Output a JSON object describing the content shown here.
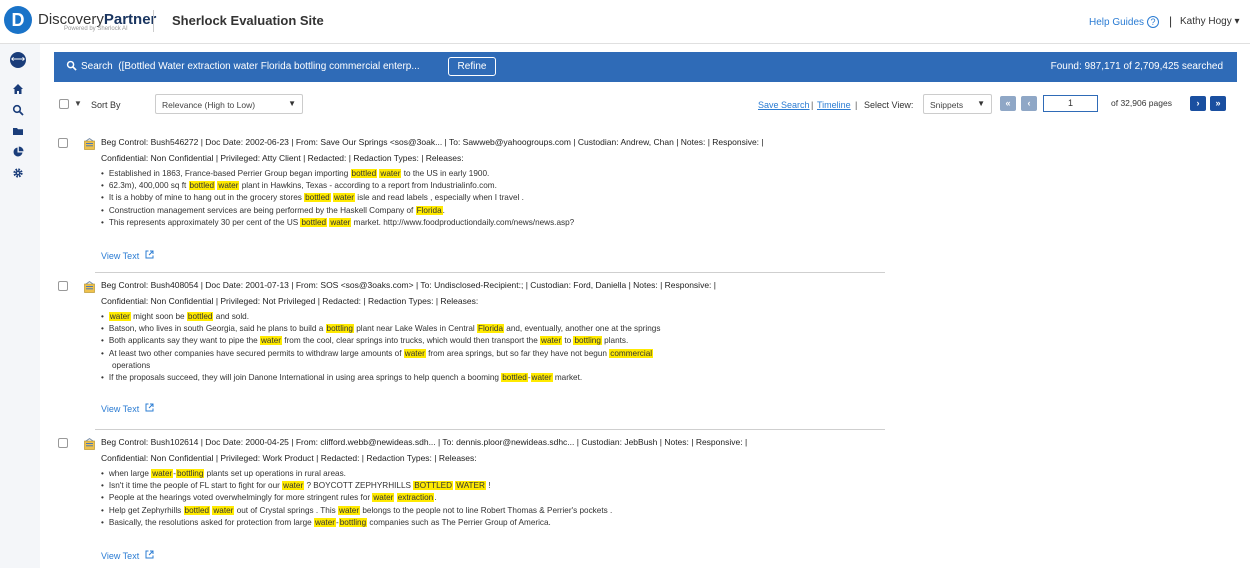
{
  "header": {
    "logo_letter": "D",
    "logo_part1": "Discovery",
    "logo_part2": "Partner",
    "logo_sub": "Powered by Sherlock AI",
    "site_title": "Sherlock Evaluation Site",
    "help_label": "Help Guides",
    "help_icon": "?",
    "user_sep": "|",
    "user_name": "Kathy Hogy ▾"
  },
  "rail": {
    "toggle_icon": "⟷",
    "items": [
      "home-icon",
      "search-icon",
      "folder-icon",
      "pie-chart-icon",
      "gear-icon"
    ]
  },
  "banner": {
    "search_label": "Search",
    "query": "([Bottled Water extraction water Florida bottling commercial enterp...",
    "refine_label": "Refine",
    "found_text": "Found: 987,171 of 2,709,425 searched",
    "color": "#2f6bb7"
  },
  "toolbar": {
    "sort_label": "Sort By",
    "sort_value": "Relevance (High to Low)",
    "save_search": "Save Search",
    "timeline": "Timeline",
    "select_view_label": "Select View:",
    "view_value": "Snippets",
    "first_label": "«",
    "prev_label": "‹",
    "page_value": "1",
    "page_total": "of 32,906 pages",
    "next_label": "›",
    "last_label": "»"
  },
  "documents": [
    {
      "meta1": "Beg Control: Bush546272  |  Doc Date: 2002-06-23  |  From: Save Our Springs <sos@3oak...  |  To: Sawweb@yahoogroups.com  |  Custodian: Andrew, Chan  |  Notes:   |  Responsive:   |",
      "meta2": "Confidential: Non Confidential  |  Privileged: Atty Client  |  Redacted:   |  Redaction Types:   |  Releases:",
      "view_text": "View Text"
    },
    {
      "meta1": "Beg Control: Bush408054  |  Doc Date: 2001-07-13  |  From: SOS <sos@3oaks.com>  |  To: Undisclosed-Recipient:;  |  Custodian: Ford, Daniella  |  Notes:   |  Responsive:   |",
      "meta2": "Confidential: Non Confidential  |  Privileged: Not Privileged  |  Redacted:   |  Redaction Types:   |  Releases:",
      "view_text": "View Text"
    },
    {
      "meta1": "Beg Control: Bush102614  |  Doc Date: 2000-04-25  |  From: clifford.webb@newideas.sdh...  |  To: dennis.ploor@newideas.sdhc...  |  Custodian: JebBush  |  Notes:   |  Responsive:   |",
      "meta2": "Confidential: Non Confidential  |  Privileged: Work Product  |  Redacted:   |  Redaction Types:   |  Releases:",
      "view_text": "View Text"
    }
  ],
  "snippets": {
    "d0": [
      [
        "Established in 1863, France-based Perrier Group began importing ",
        "bottled",
        " ",
        "water",
        " to the US in early 1900."
      ],
      [
        "62.3m), 400,000 sq ft ",
        "bottled",
        " ",
        "water",
        " plant in Hawkins, Texas - according to a report from Industrialinfo.com."
      ],
      [
        "It is a hobby of mine to hang out in the grocery stores ",
        "bottled",
        " ",
        "water",
        " isle and read labels , especially when I travel ."
      ],
      [
        "Construction management services are being performed by the Haskell Company of ",
        "Florida",
        "."
      ],
      [
        "This represents approximately 30 per cent of the US ",
        "bottled",
        " ",
        "water",
        " market. http://www.foodproductiondaily.com/news/news.asp?"
      ]
    ],
    "d1": [
      [
        "",
        "water",
        " might soon be ",
        "bottled",
        " and sold."
      ],
      [
        "Batson, who lives in south Georgia, said he plans to build a ",
        "bottling",
        " plant near Lake Wales in Central ",
        "Florida",
        " and, eventually, another one at the springs"
      ],
      [
        "Both applicants say they want to pipe the ",
        "water",
        " from the cool, clear springs into trucks, which would then transport the ",
        "water",
        " to ",
        "bottling",
        " plants."
      ],
      [
        "At least two other companies have secured permits to withdraw large amounts of ",
        "water",
        " from area springs, but so far they have not begun ",
        "commercial",
        ""
      ],
      [
        "operations"
      ],
      [
        "If the proposals succeed, they will join Danone International in using area springs to help quench a booming ",
        "bottled",
        "-",
        "water",
        " market."
      ]
    ],
    "d2": [
      [
        "when large ",
        "water",
        "-",
        "bottling",
        " plants set up operations in rural areas."
      ],
      [
        "Isn't it time the people of FL start to fight for our ",
        "water",
        " ? BOYCOTT ZEPHYRHILLS ",
        "BOTTLED",
        " ",
        "WATER",
        " !"
      ],
      [
        "People at the hearings voted overwhelmingly for more stringent rules for ",
        "water",
        " ",
        "extraction",
        "."
      ],
      [
        "Help get Zephyrhills ",
        "bottled",
        " ",
        "water",
        " out of Crystal springs . This ",
        "water",
        " belongs to the people not to line Robert Thomas & Perrier's pockets ."
      ],
      [
        "Basically, the resolutions asked for protection from large ",
        "water",
        "-",
        "bottling",
        " companies such as The Perrier Group of America."
      ]
    ]
  }
}
